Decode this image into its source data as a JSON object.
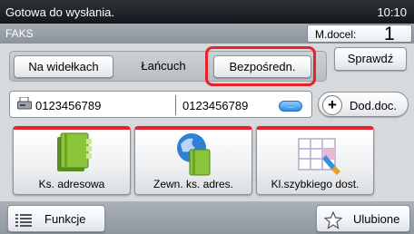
{
  "status": {
    "message": "Gotowa do wysłania.",
    "time": "10:10"
  },
  "header": {
    "title": "FAKS",
    "originals_label": "M.docel:",
    "originals_count": "1"
  },
  "dial_mode": {
    "tabs": [
      {
        "label": "Na widełkach"
      },
      {
        "label": "Łańcuch"
      },
      {
        "label": "Bezpośredn.",
        "selected": true
      }
    ]
  },
  "check_button": {
    "label": "Sprawdź"
  },
  "destination": {
    "number1": "0123456789",
    "number2": "0123456789",
    "more_label": "…"
  },
  "add_button": {
    "label": "Dod.doc."
  },
  "main_buttons": [
    {
      "label": "Ks. adresowa",
      "icon": "address-book-icon"
    },
    {
      "label": "Zewn. ks. adres.",
      "icon": "external-address-book-icon"
    },
    {
      "label": "Kl.szybkiego dost.",
      "icon": "speed-dial-icon"
    }
  ],
  "bottom": {
    "functions_label": "Funkcje",
    "favorites_label": "Ulubione"
  },
  "colors": {
    "highlight": "#e8222b",
    "accent_blue": "#2f8de9",
    "status_bar": "#1c1e22"
  }
}
